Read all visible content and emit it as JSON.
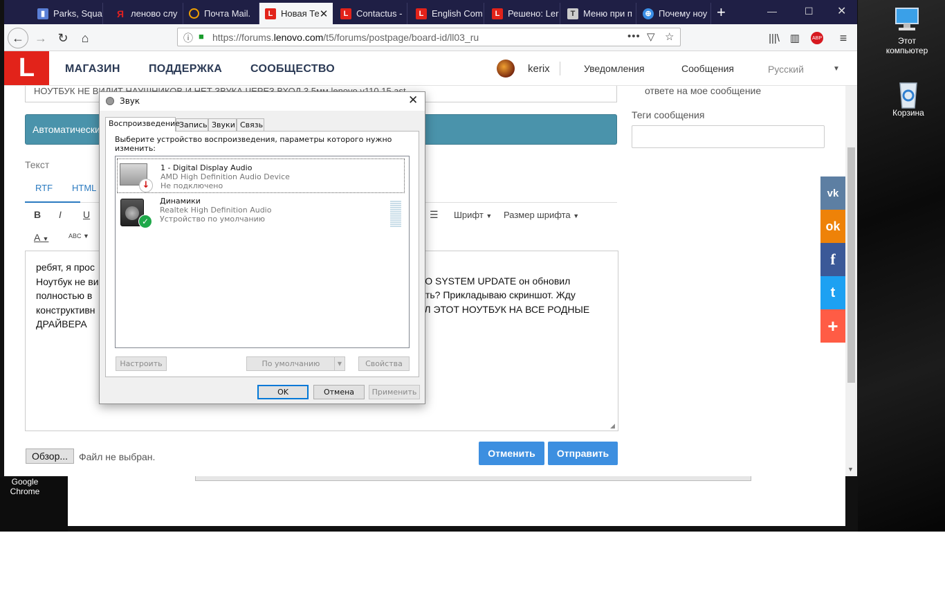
{
  "desktop": {
    "icons": [
      {
        "label_line1": "Этот",
        "label_line2": "компьютер"
      },
      {
        "label_line1": "Корзина",
        "label_line2": ""
      },
      {
        "label_line1": "Google",
        "label_line2": "Chrome"
      }
    ]
  },
  "browser": {
    "tabs": [
      {
        "label": "Parks, Squar",
        "icon": "trello-icon",
        "color": "#5a7fd6"
      },
      {
        "label": "леново слу",
        "icon": "yandex-icon",
        "color": "#e02020"
      },
      {
        "label": "Почта Mail.",
        "icon": "mail-ru-icon",
        "color": "#f0a000"
      },
      {
        "label": "Новая Те",
        "icon": "lenovo-icon",
        "color": "#e2231a",
        "active": true
      },
      {
        "label": "Contactus -",
        "icon": "lenovo-icon",
        "color": "#e2231a"
      },
      {
        "label": "English Com",
        "icon": "lenovo-icon",
        "color": "#e2231a"
      },
      {
        "label": "Решено: Ler",
        "icon": "lenovo-icon",
        "color": "#e2231a"
      },
      {
        "label": "Меню при п",
        "icon": "page-icon",
        "color": "#555"
      },
      {
        "label": "Почему ноу",
        "icon": "globe-icon",
        "color": "#3a8ee6"
      }
    ],
    "url_prefix": "https://forums.",
    "url_domain": "lenovo.com",
    "url_path": "/t5/forums/postpage/board-id/ll03_ru",
    "abp_label": "ABP"
  },
  "site": {
    "logo": "L",
    "nav": [
      "МАГАЗИН",
      "ПОДДЕРЖКА",
      "СООБЩЕСТВО"
    ],
    "username": "kerix",
    "links": [
      "Уведомления",
      "Сообщения"
    ],
    "language": "Русский",
    "brand_color": "#e2231a"
  },
  "form": {
    "subject": "НОУТБУК НЕ ВИДИТ НАУШНИКОВ И НЕТ ЗВУКА ЧЕРЕЗ ВХОД 3.5мм lenovo v110 15 ast",
    "auto_bar": "Автоматически",
    "text_label": "Текст",
    "tab_rtf": "RTF",
    "tab_html": "HTML",
    "toolbar": {
      "bold": "B",
      "italic": "I",
      "underline": "U",
      "font_color": "A",
      "spellcheck": "ABC",
      "font": "Шрифт",
      "font_size": "Размер шрифта"
    },
    "body_lines": [
      "ребят, я прос",
      "Ноутбук не ви",
      "полностью в",
      "конструктивн",
      "ДРАЙВЕРА"
    ],
    "body_right_lines": [
      "OVO SYSTEM UPDATE он обновил",
      "елать? Прикладываю скриншот. Жду",
      "ВИЛ ЭТОТ НОУТБУК НА ВСЕ РОДНЫЕ"
    ],
    "browse_label": "Обзор...",
    "no_file": "Файл не выбран.",
    "cancel_label": "Отменить",
    "submit_label": "Отправить",
    "right_text": "ответе на мое сообщение",
    "tags_label": "Теги сообщения"
  },
  "social": [
    {
      "name": "vk-icon",
      "glyph": "vk",
      "color": "#5d7fa3"
    },
    {
      "name": "odnoklassniki-icon",
      "glyph": "ok",
      "color": "#ee8208"
    },
    {
      "name": "facebook-icon",
      "glyph": "f",
      "color": "#3b5998"
    },
    {
      "name": "twitter-icon",
      "glyph": "t",
      "color": "#1da1f2"
    },
    {
      "name": "share-plus-icon",
      "glyph": "+",
      "color": "#ff5c45"
    }
  ],
  "dialog": {
    "title": "Звук",
    "tabs": [
      "Воспроизведение",
      "Запись",
      "Звуки",
      "Связь"
    ],
    "instruction": "Выберите устройство воспроизведения, параметры которого нужно изменить:",
    "devices": [
      {
        "name": "1 - Digital Display Audio",
        "driver": "AMD High Definition Audio Device",
        "status": "Не подключено"
      },
      {
        "name": "Динамики",
        "driver": "Realtek High Definition Audio",
        "status": "Устройство по умолчанию"
      }
    ],
    "configure_label": "Настроить",
    "default_label": "По умолчанию",
    "properties_label": "Свойства",
    "ok_label": "OK",
    "cancel_label": "Отмена",
    "apply_label": "Применить"
  }
}
